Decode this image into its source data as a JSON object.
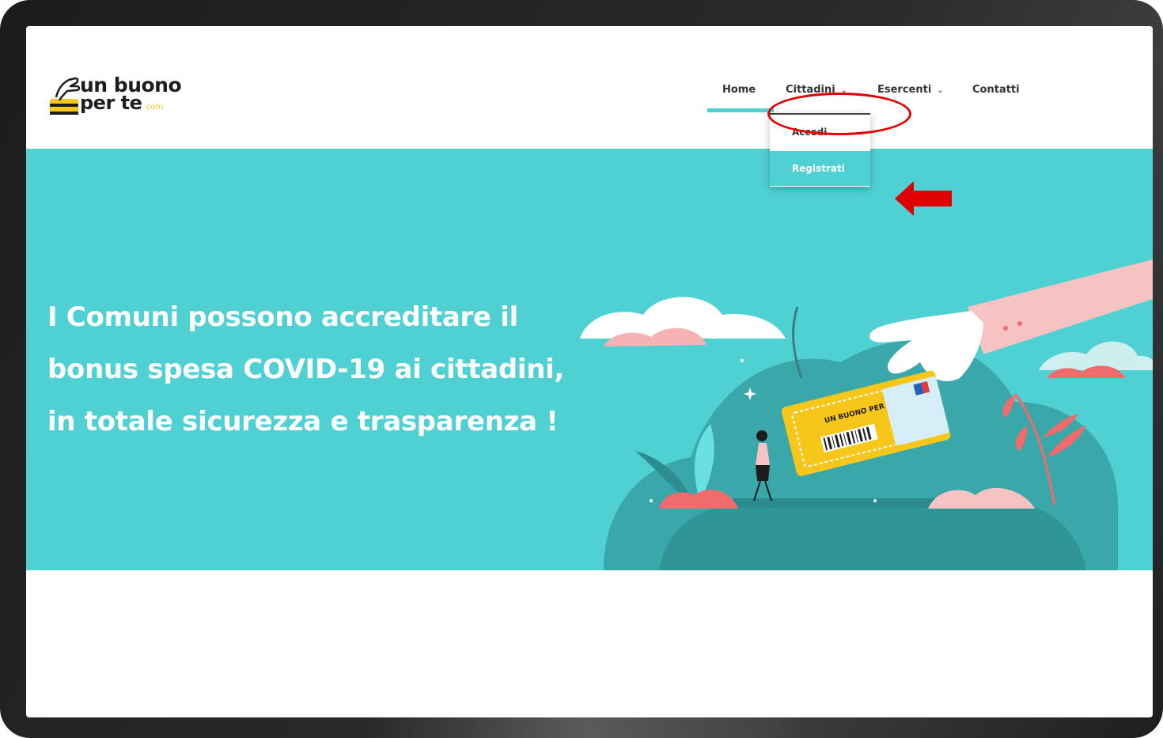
{
  "brand": {
    "line1": "un buono",
    "line2": "per te",
    "suffix": "com",
    "colors": {
      "yellow": "#f6c619",
      "dark": "#1d1d1b"
    }
  },
  "nav": {
    "items": [
      {
        "label": "Home",
        "active": true
      },
      {
        "label": "Cittadini",
        "has_dropdown": true
      },
      {
        "label": "Esercenti",
        "has_dropdown": true
      },
      {
        "label": "Contatti"
      }
    ],
    "dropdown": {
      "items": [
        {
          "label": "Accedi"
        },
        {
          "label": "Registrati",
          "highlighted": true
        }
      ]
    }
  },
  "hero": {
    "lines": [
      "I Comuni possono accreditare il",
      "bonus spesa COVID-19 ai cittadini,",
      "in totale sicurezza e trasparenza !"
    ],
    "background": "#4fd1d4",
    "illustration": {
      "ticket_text": "UN BUONO PER TE"
    }
  },
  "annotations": {
    "highlight_color": "#e00000",
    "circled_item": "Cittadini",
    "arrow_target": "Registrati"
  },
  "icons": [
    "chevron-down-icon",
    "logo-hand-card-icon",
    "red-arrow-left-icon"
  ]
}
